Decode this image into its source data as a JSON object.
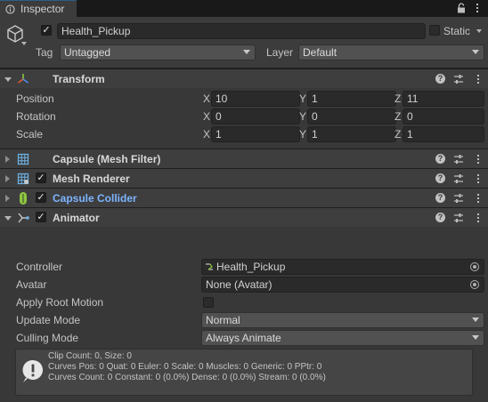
{
  "tab": {
    "label": "Inspector",
    "icon": "info-icon"
  },
  "window_controls": {
    "lock": "lock-icon",
    "menu": "kebab-menu-icon"
  },
  "object": {
    "icon": "cube-icon",
    "active": true,
    "name": "Health_Pickup",
    "static_label": "Static",
    "static_checked": false,
    "tag_label": "Tag",
    "tag_value": "Untagged",
    "layer_label": "Layer",
    "layer_value": "Default"
  },
  "transform": {
    "title": "Transform",
    "rows": [
      {
        "label": "Position",
        "x": "10",
        "y": "1",
        "z": "11"
      },
      {
        "label": "Rotation",
        "x": "0",
        "y": "0",
        "z": "0"
      },
      {
        "label": "Scale",
        "x": "1",
        "y": "1",
        "z": "1"
      }
    ],
    "axis": {
      "x": "X",
      "y": "Y",
      "z": "Z"
    }
  },
  "components": [
    {
      "title": "Capsule (Mesh Filter)",
      "icon": "mesh-filter-icon",
      "has_checkbox": false,
      "expanded": false
    },
    {
      "title": "Mesh Renderer",
      "icon": "mesh-renderer-icon",
      "has_checkbox": true,
      "expanded": false
    },
    {
      "title": "Capsule Collider",
      "icon": "capsule-collider-icon",
      "has_checkbox": true,
      "expanded": false,
      "highlight_color": "#7cb4ff"
    },
    {
      "title": "Animator",
      "icon": "animator-icon",
      "has_checkbox": true,
      "expanded": true
    }
  ],
  "animator": {
    "controller_label": "Controller",
    "controller_value": "Health_Pickup",
    "avatar_label": "Avatar",
    "avatar_value": "None (Avatar)",
    "apply_root_motion_label": "Apply Root Motion",
    "apply_root_motion": false,
    "update_mode_label": "Update Mode",
    "update_mode_value": "Normal",
    "culling_mode_label": "Culling Mode",
    "culling_mode_value": "Always Animate",
    "info": {
      "icon": "info-alert-icon",
      "lines": [
        "Clip Count: 0, Size: 0",
        "Curves Pos: 0 Quat: 0 Euler: 0 Scale: 0 Muscles: 0 Generic: 0 PPtr: 0",
        "Curves Count: 0 Constant: 0 (0.0%) Dense: 0 (0.0%) Stream: 0 (0.0%)"
      ]
    }
  },
  "colors": {
    "background": "#383838",
    "header": "#3c3c3c",
    "field": "#2a2a2a",
    "accent": "#7cb4ff"
  }
}
